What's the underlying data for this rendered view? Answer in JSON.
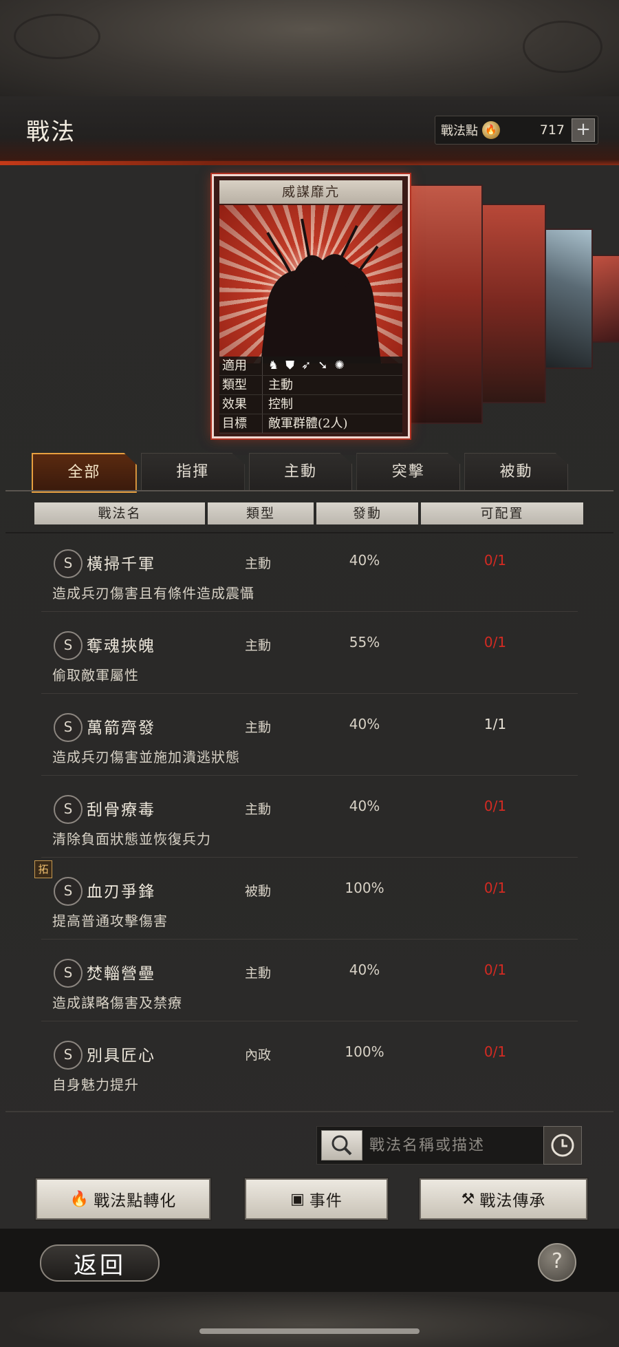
{
  "header": {
    "title": "戰法",
    "points_label": "戰法點",
    "points_value": "717",
    "plus_label": "+"
  },
  "card": {
    "title": "威謀靡亢",
    "rows": [
      {
        "key": "適用",
        "value": ""
      },
      {
        "key": "類型",
        "value": "主動"
      },
      {
        "key": "效果",
        "value": "控制"
      },
      {
        "key": "目標",
        "value": "敵軍群體(2人)"
      }
    ],
    "apply_icons": [
      "cavalry-icon",
      "shield-icon",
      "bow-icon",
      "spear-icon",
      "wheel-icon"
    ]
  },
  "tabs": [
    {
      "label": "全部",
      "active": true
    },
    {
      "label": "指揮",
      "active": false
    },
    {
      "label": "主動",
      "active": false
    },
    {
      "label": "突擊",
      "active": false
    },
    {
      "label": "被動",
      "active": false
    }
  ],
  "columns": [
    "戰法名",
    "類型",
    "發動",
    "可配置"
  ],
  "skills": [
    {
      "grade": "S",
      "name": "橫掃千軍",
      "type": "主動",
      "rate": "40%",
      "config": "0/1",
      "config_color": "#d42a22",
      "desc": "造成兵刃傷害且有條件造成震懾"
    },
    {
      "grade": "S",
      "name": "奪魂挾魄",
      "type": "主動",
      "rate": "55%",
      "config": "0/1",
      "config_color": "#d42a22",
      "desc": "偷取敵軍屬性"
    },
    {
      "grade": "S",
      "name": "萬箭齊發",
      "type": "主動",
      "rate": "40%",
      "config": "1/1",
      "config_color": "#e8e2d6",
      "desc": "造成兵刃傷害並施加潰逃狀態"
    },
    {
      "grade": "S",
      "name": "刮骨療毒",
      "type": "主動",
      "rate": "40%",
      "config": "0/1",
      "config_color": "#d42a22",
      "desc": "清除負面狀態並恢復兵力"
    },
    {
      "grade": "S",
      "name": "血刃爭鋒",
      "type": "被動",
      "rate": "100%",
      "config": "0/1",
      "config_color": "#d42a22",
      "desc": "提高普通攻擊傷害",
      "badge": "拓"
    },
    {
      "grade": "S",
      "name": "焚輜營壘",
      "type": "主動",
      "rate": "40%",
      "config": "0/1",
      "config_color": "#d42a22",
      "desc": "造成謀略傷害及禁療"
    },
    {
      "grade": "S",
      "name": "別具匠心",
      "type": "內政",
      "rate": "100%",
      "config": "0/1",
      "config_color": "#d42a22",
      "desc": "自身魅力提升"
    }
  ],
  "search": {
    "placeholder": "戰法名稱或描述"
  },
  "buttons": {
    "convert": "戰法點轉化",
    "event": "事件",
    "inherit": "戰法傳承"
  },
  "footer": {
    "back": "返回",
    "help": "?"
  }
}
